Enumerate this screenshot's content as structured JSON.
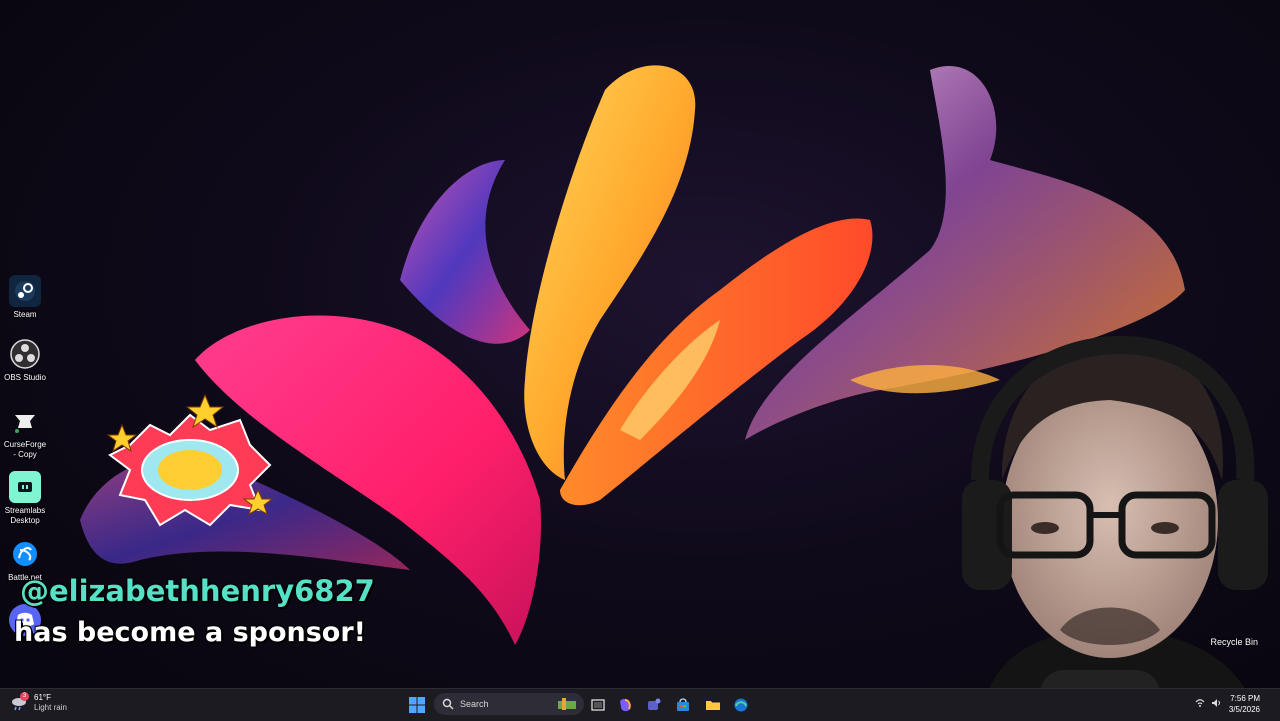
{
  "desktop": {
    "icons": [
      {
        "label": "Steam",
        "icon": "steam-icon"
      },
      {
        "label": "OBS Studio",
        "icon": "obs-icon"
      },
      {
        "label": "CurseForge - Copy",
        "icon": "curseforge-icon"
      },
      {
        "label": "Streamlabs Desktop",
        "icon": "streamlabs-icon"
      },
      {
        "label": "Battle.net",
        "icon": "battlenet-icon"
      }
    ],
    "recycle_bin": "Recycle Bin"
  },
  "alert": {
    "handle": "@elizabethhenry6827",
    "message": "has become a sponsor!"
  },
  "taskbar": {
    "weather": {
      "temp": "61°F",
      "condition": "Light rain",
      "badge": "3"
    },
    "search_placeholder": "Search",
    "clock": {
      "time": "7:56 PM",
      "date": "3/5/2026"
    }
  },
  "colors": {
    "handle": "#56e0c5",
    "taskbar": "#1c1b22",
    "accent": "#4fa8ff"
  }
}
